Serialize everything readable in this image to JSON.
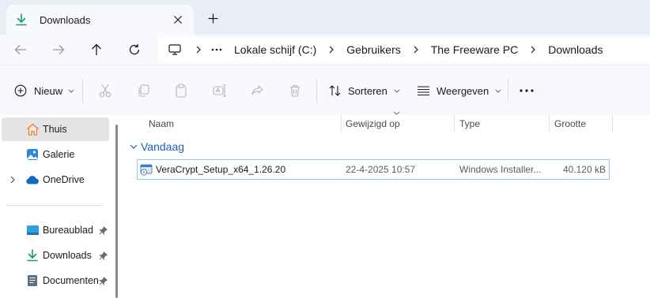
{
  "tab": {
    "title": "Downloads"
  },
  "address": {
    "crumbs": [
      "Lokale schijf (C:)",
      "Gebruikers",
      "The Freeware PC",
      "Downloads"
    ]
  },
  "commands": {
    "new_label": "Nieuw",
    "sort_label": "Sorteren",
    "view_label": "Weergeven"
  },
  "sidebar": {
    "items": [
      {
        "label": "Thuis"
      },
      {
        "label": "Galerie"
      },
      {
        "label": "OneDrive"
      },
      {
        "label": "Bureaublad"
      },
      {
        "label": "Downloads"
      },
      {
        "label": "Documenten"
      }
    ]
  },
  "columns": {
    "name": "Naam",
    "modified": "Gewijzigd op",
    "type": "Type",
    "size": "Grootte"
  },
  "group": {
    "label": "Vandaag"
  },
  "files": [
    {
      "name": "VeraCrypt_Setup_x64_1.26.20",
      "modified": "22-4-2025 10:57",
      "type": "Windows Installer...",
      "size": "40.120 kB"
    }
  ],
  "colors": {
    "accent": "#1a5fb4",
    "download_green": "#1d9a6c",
    "tabbar_bg": "#e9eef6",
    "selection_border": "#9ec3e6"
  }
}
